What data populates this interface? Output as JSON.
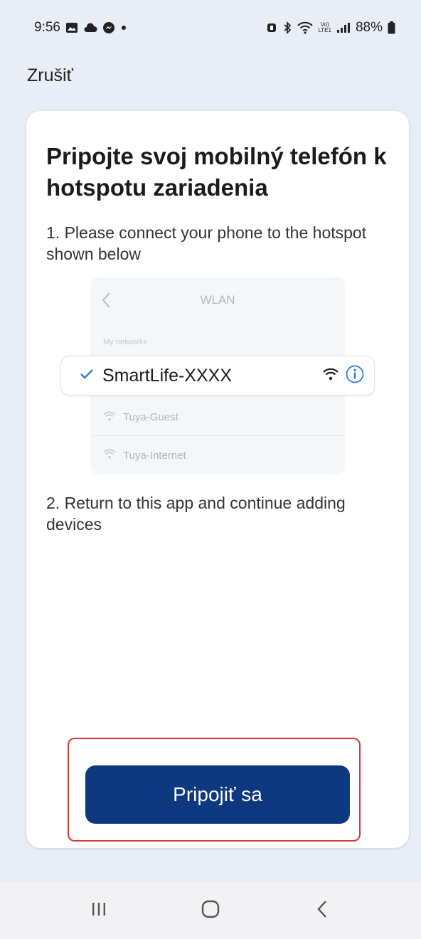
{
  "status_bar": {
    "time": "9:56",
    "battery": "88%",
    "net_badge_top": "Vo)",
    "net_badge_bottom": "LTE1"
  },
  "header": {
    "cancel_label": "Zrušiť"
  },
  "content": {
    "title": "Pripojte svoj mobilný telefón k hotspotu zariadenia",
    "step1": "1. Please connect your phone to the hotspot shown below",
    "step2": "2. Return to this app and continue adding devices"
  },
  "illustration": {
    "header_title": "WLAN",
    "section_label": "My networks",
    "selected_network": "SmartLife-XXXX",
    "networks": [
      "Tuya-Guest",
      "Tuya-Internet"
    ]
  },
  "actions": {
    "connect_label": "Pripojiť sa"
  },
  "colors": {
    "accent": "#0e3880",
    "highlight": "#d33a3a",
    "check": "#2a7de1",
    "background": "#e9eef6"
  },
  "icons": [
    "gallery-icon",
    "cloud-icon",
    "messenger-icon",
    "alarm-icon",
    "bluetooth-icon",
    "wifi-icon",
    "signal-icon",
    "battery-icon",
    "back-chevron-icon",
    "checkmark-icon",
    "info-icon",
    "recent-apps-icon",
    "home-icon",
    "back-icon"
  ]
}
